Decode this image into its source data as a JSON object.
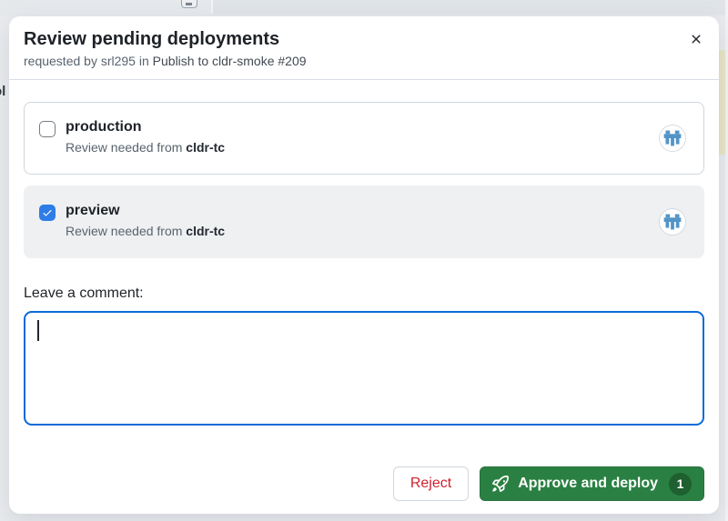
{
  "background": {
    "artifact_text": "ol"
  },
  "modal": {
    "title": "Review pending deployments",
    "subtitle_prefix": "requested by srl295 in",
    "subtitle_run": "Publish to cldr-smoke #209"
  },
  "environments": [
    {
      "name": "production",
      "note_prefix": "Review needed from",
      "team": "cldr-tc",
      "checked": false
    },
    {
      "name": "preview",
      "note_prefix": "Review needed from",
      "team": "cldr-tc",
      "checked": true
    }
  ],
  "comment": {
    "label": "Leave a comment:",
    "value": ""
  },
  "actions": {
    "reject_label": "Reject",
    "approve_label": "Approve and deploy",
    "approve_count": "1"
  },
  "icons": {
    "close": "x-icon",
    "checkbox_check": "check-icon",
    "team_avatar": "cldr-tc-team-avatar-icon",
    "approve": "rocket-icon"
  },
  "colors": {
    "accent_blue": "#0969da",
    "checkbox_blue": "#2e7ce8",
    "success_green": "#2a8042",
    "badge_green": "#1e6030",
    "danger_red": "#cf222e",
    "avatar_blue": "#5294c7",
    "page_background": "#e9ebee"
  }
}
